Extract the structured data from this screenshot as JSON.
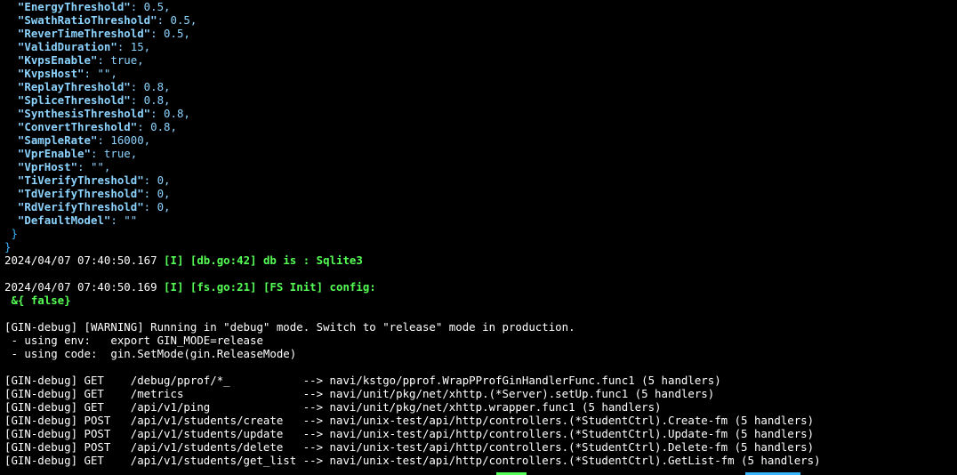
{
  "config_lines": [
    {
      "key": "\"EnergyThreshold\"",
      "rest": ": 0.5,"
    },
    {
      "key": "\"SwathRatioThreshold\"",
      "rest": ": 0.5,"
    },
    {
      "key": "\"ReverTimeThreshold\"",
      "rest": ": 0.5,"
    },
    {
      "key": "\"ValidDuration\"",
      "rest": ": 15,"
    },
    {
      "key": "\"KvpsEnable\"",
      "rest": ": true,"
    },
    {
      "key": "\"KvpsHost\"",
      "rest": ": \"\","
    },
    {
      "key": "\"ReplayThreshold\"",
      "rest": ": 0.8,"
    },
    {
      "key": "\"SpliceThreshold\"",
      "rest": ": 0.8,"
    },
    {
      "key": "\"SynthesisThreshold\"",
      "rest": ": 0.8,"
    },
    {
      "key": "\"ConvertThreshold\"",
      "rest": ": 0.8,"
    },
    {
      "key": "\"SampleRate\"",
      "rest": ": 16000,"
    },
    {
      "key": "\"VprEnable\"",
      "rest": ": true,"
    },
    {
      "key": "\"VprHost\"",
      "rest": ": \"\","
    },
    {
      "key": "\"TiVerifyThreshold\"",
      "rest": ": 0,"
    },
    {
      "key": "\"TdVerifyThreshold\"",
      "rest": ": 0,"
    },
    {
      "key": "\"RdVerifyThreshold\"",
      "rest": ": 0,"
    },
    {
      "key": "\"DefaultModel\"",
      "rest": ": \"\""
    }
  ],
  "close_inner": " }",
  "close_outer": "}",
  "log_db": {
    "timestamp": "2024/04/07 07:40:50.167 ",
    "message": "[I] [db.go:42] db is : Sqlite3"
  },
  "log_fs": {
    "timestamp": "2024/04/07 07:40:50.169 ",
    "message": "[I] [fs.go:21] [FS Init] config:"
  },
  "fs_value": " &{ false}",
  "gin_warning": [
    "[GIN-debug] [WARNING] Running in \"debug\" mode. Switch to \"release\" mode in production.",
    " - using env:   export GIN_MODE=release",
    " - using code:  gin.SetMode(gin.ReleaseMode)"
  ],
  "gin_routes": [
    "[GIN-debug] GET    /debug/pprof/*_           --> navi/kstgo/pprof.WrapPProfGinHandlerFunc.func1 (5 handlers)",
    "[GIN-debug] GET    /metrics                  --> navi/unit/pkg/net/xhttp.(*Server).setUp.func1 (5 handlers)",
    "[GIN-debug] GET    /api/v1/ping              --> navi/unit/pkg/net/xhttp.wrapper.func1 (5 handlers)",
    "[GIN-debug] POST   /api/v1/students/create   --> navi/unix-test/api/http/controllers.(*StudentCtrl).Create-fm (5 handlers)",
    "[GIN-debug] POST   /api/v1/students/update   --> navi/unix-test/api/http/controllers.(*StudentCtrl).Update-fm (5 handlers)",
    "[GIN-debug] POST   /api/v1/students/delete   --> navi/unix-test/api/http/controllers.(*StudentCtrl).Delete-fm (5 handlers)",
    "[GIN-debug] GET    /api/v1/students/get_list --> navi/unix-test/api/http/controllers.(*StudentCtrl).GetList-fm (5 handlers)"
  ],
  "colors": {
    "background": "#000000",
    "key": "#8cd4ff",
    "log_green": "#55ff55",
    "brace_blue": "#3cb5ff",
    "text": "#ffffff"
  }
}
